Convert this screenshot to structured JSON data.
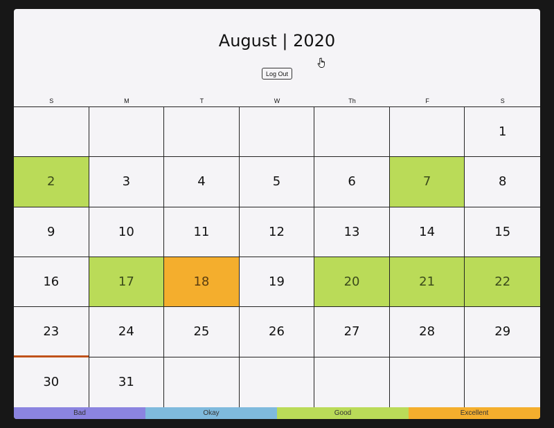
{
  "header": {
    "title": "August | 2020",
    "logout_label": "Log Out"
  },
  "weekdays": [
    "S",
    "M",
    "T",
    "W",
    "Th",
    "F",
    "S"
  ],
  "days": [
    {
      "label": "",
      "rating": ""
    },
    {
      "label": "",
      "rating": ""
    },
    {
      "label": "",
      "rating": ""
    },
    {
      "label": "",
      "rating": ""
    },
    {
      "label": "",
      "rating": ""
    },
    {
      "label": "",
      "rating": ""
    },
    {
      "label": "1",
      "rating": ""
    },
    {
      "label": "2",
      "rating": "good"
    },
    {
      "label": "3",
      "rating": ""
    },
    {
      "label": "4",
      "rating": ""
    },
    {
      "label": "5",
      "rating": ""
    },
    {
      "label": "6",
      "rating": ""
    },
    {
      "label": "7",
      "rating": "good"
    },
    {
      "label": "8",
      "rating": ""
    },
    {
      "label": "9",
      "rating": ""
    },
    {
      "label": "10",
      "rating": ""
    },
    {
      "label": "11",
      "rating": ""
    },
    {
      "label": "12",
      "rating": ""
    },
    {
      "label": "13",
      "rating": ""
    },
    {
      "label": "14",
      "rating": ""
    },
    {
      "label": "15",
      "rating": ""
    },
    {
      "label": "16",
      "rating": ""
    },
    {
      "label": "17",
      "rating": "good"
    },
    {
      "label": "18",
      "rating": "excellent"
    },
    {
      "label": "19",
      "rating": ""
    },
    {
      "label": "20",
      "rating": "good"
    },
    {
      "label": "21",
      "rating": "good"
    },
    {
      "label": "22",
      "rating": "good"
    },
    {
      "label": "23",
      "rating": "",
      "today": true
    },
    {
      "label": "24",
      "rating": ""
    },
    {
      "label": "25",
      "rating": ""
    },
    {
      "label": "26",
      "rating": ""
    },
    {
      "label": "27",
      "rating": ""
    },
    {
      "label": "28",
      "rating": ""
    },
    {
      "label": "29",
      "rating": ""
    },
    {
      "label": "30",
      "rating": ""
    },
    {
      "label": "31",
      "rating": ""
    },
    {
      "label": "",
      "rating": ""
    },
    {
      "label": "",
      "rating": ""
    },
    {
      "label": "",
      "rating": ""
    },
    {
      "label": "",
      "rating": ""
    },
    {
      "label": "",
      "rating": ""
    }
  ],
  "legend": [
    {
      "label": "Bad",
      "color": "#8b84e0"
    },
    {
      "label": "Okay",
      "color": "#7fbadd"
    },
    {
      "label": "Good",
      "color": "#badb58"
    },
    {
      "label": "Excellent",
      "color": "#f4ae2d"
    }
  ],
  "colors": {
    "good": "#badb58",
    "excellent": "#f4ae2d",
    "today_marker": "#c0521a"
  },
  "icons": {
    "cursor": "hand-pointer-icon"
  }
}
